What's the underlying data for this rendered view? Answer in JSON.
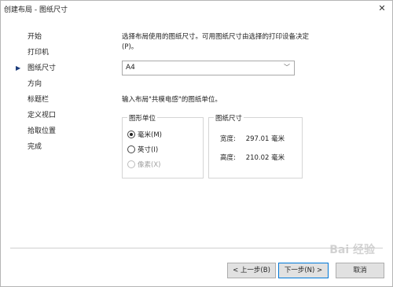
{
  "window": {
    "title": "创建布局 - 图纸尺寸"
  },
  "sidebar": {
    "items": [
      {
        "label": "开始",
        "active": false
      },
      {
        "label": "打印机",
        "active": false
      },
      {
        "label": "图纸尺寸",
        "active": true
      },
      {
        "label": "方向",
        "active": false
      },
      {
        "label": "标题栏",
        "active": false
      },
      {
        "label": "定义视口",
        "active": false
      },
      {
        "label": "拾取位置",
        "active": false
      },
      {
        "label": "完成",
        "active": false
      }
    ]
  },
  "main": {
    "description": "选择布局使用的图纸尺寸。可用图纸尺寸由选择的打印设备决定(P)。",
    "paper_select": {
      "value": "A4"
    },
    "units_prompt": "输入布局\"共模电感\"的图纸单位。",
    "units_group": {
      "title": "图形单位",
      "options": [
        {
          "label": "毫米(M)",
          "checked": true,
          "disabled": false
        },
        {
          "label": "英寸(I)",
          "checked": false,
          "disabled": false
        },
        {
          "label": "像素(X)",
          "checked": false,
          "disabled": true
        }
      ]
    },
    "size_group": {
      "title": "图纸尺寸",
      "width_label": "宽度:",
      "width_value": "297.01 毫米",
      "height_label": "高度:",
      "height_value": "210.02 毫米"
    }
  },
  "buttons": {
    "back": "< 上一步(B)",
    "next": "下一步(N) >",
    "cancel": "取消"
  },
  "watermark": "Bai 经验"
}
